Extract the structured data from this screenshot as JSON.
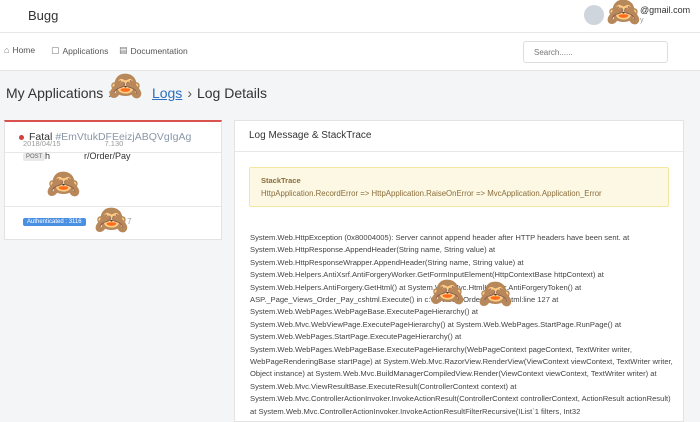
{
  "header": {
    "brand": "Bugg",
    "user_email": "@gmail.com",
    "user_sub": "y"
  },
  "nav": {
    "items": [
      {
        "icon": "home-icon",
        "label": "Home"
      },
      {
        "icon": "file-icon",
        "label": "Applications"
      },
      {
        "icon": "document-icon",
        "label": "Documentation"
      }
    ],
    "search_placeholder": "Search......"
  },
  "breadcrumb": {
    "items": [
      "My Applications",
      "Logs",
      "Log Details"
    ]
  },
  "log": {
    "level": "Fatal",
    "id": "#EmVtukDFEeizjABQVgIgAg",
    "time": "2018/04/15",
    "time_tail": "7.130",
    "method": "POST",
    "path_prefix": "h",
    "path": "r/Order/Pay",
    "auth_badge": "Authenticated : 3116",
    "auth_extra_a": "5.1",
    "auth_extra_b": "7"
  },
  "detail": {
    "title": "Log Message & StackTrace",
    "stack_title": "StackTrace",
    "stack_summary": "HttpApplication.RecordError => HttpApplication.RaiseOnError => MvcApplication.Application_Error",
    "trace": "System.Web.HttpException (0x80004005): Server cannot append header after HTTP headers have been sent. at System.Web.HttpResponse.AppendHeader(String name, String value) at System.Web.HttpResponseWrapper.AppendHeader(String name, String value) at System.Web.Helpers.AntiXsrf.AntiForgeryWorker.GetFormInputElement(HttpContextBase httpContext) at System.Web.Helpers.AntiForgery.GetHtml() at System.Web.Mvc.HtmlHelper.AntiForgeryToken() at ASP._Page_Views_Order_Pay_cshtml.Execute() in c:\\...\\Views\\Order\\Pay.cshtml:line 127 at System.Web.WebPages.WebPageBase.ExecutePageHierarchy() at System.Web.Mvc.WebViewPage.ExecutePageHierarchy() at System.Web.WebPages.StartPage.RunPage() at System.Web.WebPages.StartPage.ExecutePageHierarchy() at System.Web.WebPages.WebPageBase.ExecutePageHierarchy(WebPageContext pageContext, TextWriter writer, WebPageRenderingBase startPage) at System.Web.Mvc.RazorView.RenderView(ViewContext viewContext, TextWriter writer, Object instance) at System.Web.Mvc.BuildManagerCompiledView.Render(ViewContext viewContext, TextWriter writer) at System.Web.Mvc.ViewResultBase.ExecuteResult(ControllerContext context) at System.Web.Mvc.ControllerActionInvoker.InvokeActionResult(ControllerContext controllerContext, ActionResult actionResult) at System.Web.Mvc.ControllerActionInvoker.InvokeActionResultFilterRecursive(IList`1 filters, Int32"
  },
  "decor": {
    "monkey": "🙈"
  }
}
